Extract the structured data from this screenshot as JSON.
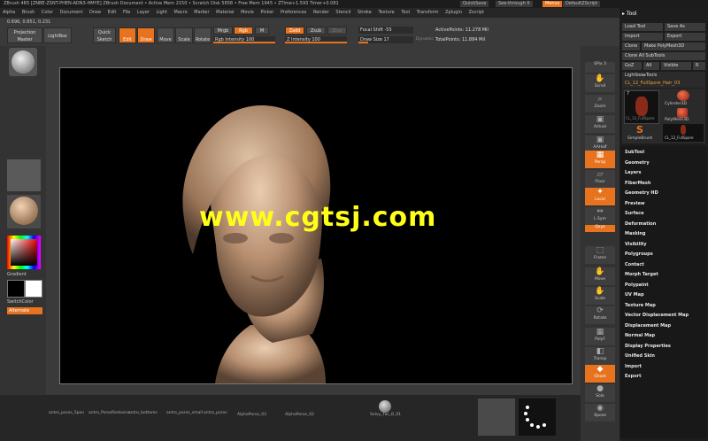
{
  "titlebar": {
    "text": "ZBrush 4R5  [ZNBE-ZSNT-PHEN-ADN3-HMYE]    ZBrush Document    • Active Mem 2150  • Scratch Disk 5658  • Free Mem 1945  • ZTime+1.593  Timer+0.081",
    "quicksave": "QuickSave",
    "seethrough": "See-through  0",
    "menus": "Menus",
    "defaultzscript": "DefaultZScript"
  },
  "menubar": [
    "Alpha",
    "Brush",
    "Color",
    "Document",
    "Draw",
    "Edit",
    "File",
    "Layer",
    "Light",
    "Macro",
    "Marker",
    "Material",
    "Movie",
    "Picker",
    "Preferences",
    "Render",
    "Stencil",
    "Stroke",
    "Texture",
    "Tool",
    "Transform",
    "Zplugin",
    "Zscript"
  ],
  "coords": "0.696, 0.851, 0.231",
  "toolbar": {
    "projection_master": "Projection Master",
    "lightbox": "LightBox",
    "quick_sketch": "Quick Sketch",
    "edit": "Edit",
    "draw": "Draw",
    "move": "Move",
    "scale": "Scale",
    "rotate": "Rotate",
    "mrgb": "Mrgb",
    "rgb": "Rgb",
    "m": "M",
    "rgb_intensity": "Rgb Intensity 100",
    "zadd": "Zadd",
    "zsub": "Zsub",
    "zcut": "Zcut",
    "z_intensity": "Z Intensity 100",
    "focal_shift": "Focal Shift -55",
    "draw_size": "Draw Size 17",
    "dynamic": "Dynamic",
    "active_points": "ActivePoints: 11.278 Mil",
    "total_points": "TotalPoints: 11.884 Mil",
    "rgb_intensity_pct": 100,
    "z_intensity_pct": 100,
    "draw_size_pct": 17
  },
  "leftshelf": {
    "gradient": "Gradient",
    "switchcolor": "SwitchColor",
    "alternate": "Alternate"
  },
  "rightshelf": [
    "SPix 3",
    "Scroll",
    "Zoom",
    "Actual",
    "AAHalf",
    "Persp",
    "Floor",
    "Local",
    "L.Sym",
    "Qxyz",
    "Frame",
    "Move",
    "Scale",
    "Rotate",
    "PolyF",
    "Transp",
    "Ghost",
    "Solo",
    "Xpose"
  ],
  "toolpanel": {
    "title": "Tool",
    "load_tool": "Load Tool",
    "save_as": "Save As",
    "import": "Import",
    "export": "Export",
    "clone": "Clone",
    "make_polymesh3d": "Make PolyMesh3D",
    "clone_all_subtools": "Clone All SubTools",
    "goz": "GoZ",
    "all": "All",
    "visible": "Visible",
    "r": "R",
    "lightbox_tools": "Lightbox▸Tools",
    "current_tool": "CL_12_FullSpore_Hair_03",
    "thumbs": [
      "CL_12_FullSpore",
      "Cylinder3D",
      "PolyMesh3D",
      "SimpleBrush",
      "CL_12_FullSpore"
    ],
    "thumb_count": "7",
    "menu_items": [
      "SubTool",
      "Geometry",
      "Layers",
      "FiberMesh",
      "Geometry HD",
      "Preview",
      "Surface",
      "Deformation",
      "Masking",
      "Visibility",
      "Polygroups",
      "Contact",
      "Morph Target",
      "Polypaint",
      "UV Map",
      "Texture Map",
      "Vector Displacement Map",
      "Displacement Map",
      "Normal Map",
      "Display Properties",
      "Unified Skin",
      "Import",
      "Export"
    ]
  },
  "bottom": [
    "antro_poros_Spon",
    "antro_PorosRedovice",
    "antro_bottoms",
    "antro_poros_small",
    "antro_poros",
    "AlphaPoros_03",
    "AlphaPoros_02",
    "Selvy_Fas_B_01"
  ],
  "watermark": "www.cgtsj.com",
  "colors": {
    "accent": "#e8731f",
    "watermark": "#ffff1a",
    "panel": "#1d1d1d"
  }
}
